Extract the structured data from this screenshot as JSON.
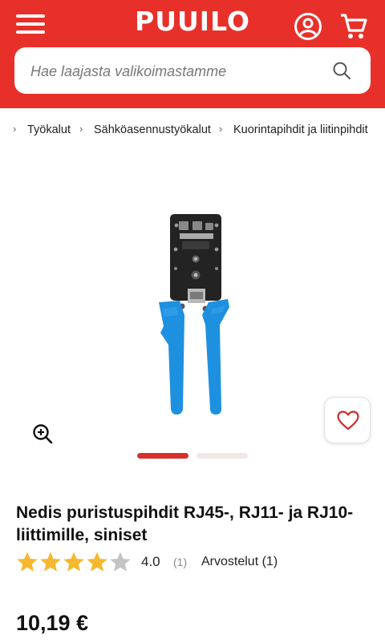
{
  "header": {
    "logo_text": "PUUILO",
    "brand_color": "#e8302a",
    "menu_icon": "hamburger-icon",
    "account_icon": "account-icon",
    "cart_icon": "cart-icon"
  },
  "search": {
    "placeholder": "Hae laajasta valikoimastamme",
    "icon": "search-icon"
  },
  "breadcrumb": {
    "items": [
      "Työkalut",
      "Sähköasennustyökalut",
      "Kuorintapihdit ja liitinpihdit"
    ]
  },
  "gallery": {
    "image_count": 2,
    "active_index": 0,
    "zoom_icon": "zoom-in-icon",
    "favorite_icon": "heart-icon",
    "active_dot_color": "#d8302b",
    "inactive_dot_color": "#efe8e6"
  },
  "product": {
    "title": "Nedis puristuspihdit RJ45-, RJ11- ja RJ10-liittimille, siniset",
    "rating": 4.0,
    "rating_text": "4.0",
    "rating_count": "(1)",
    "reviews_link": "Arvostelut (1)",
    "star_color": "#f5b82e",
    "price": "10,19 €"
  }
}
